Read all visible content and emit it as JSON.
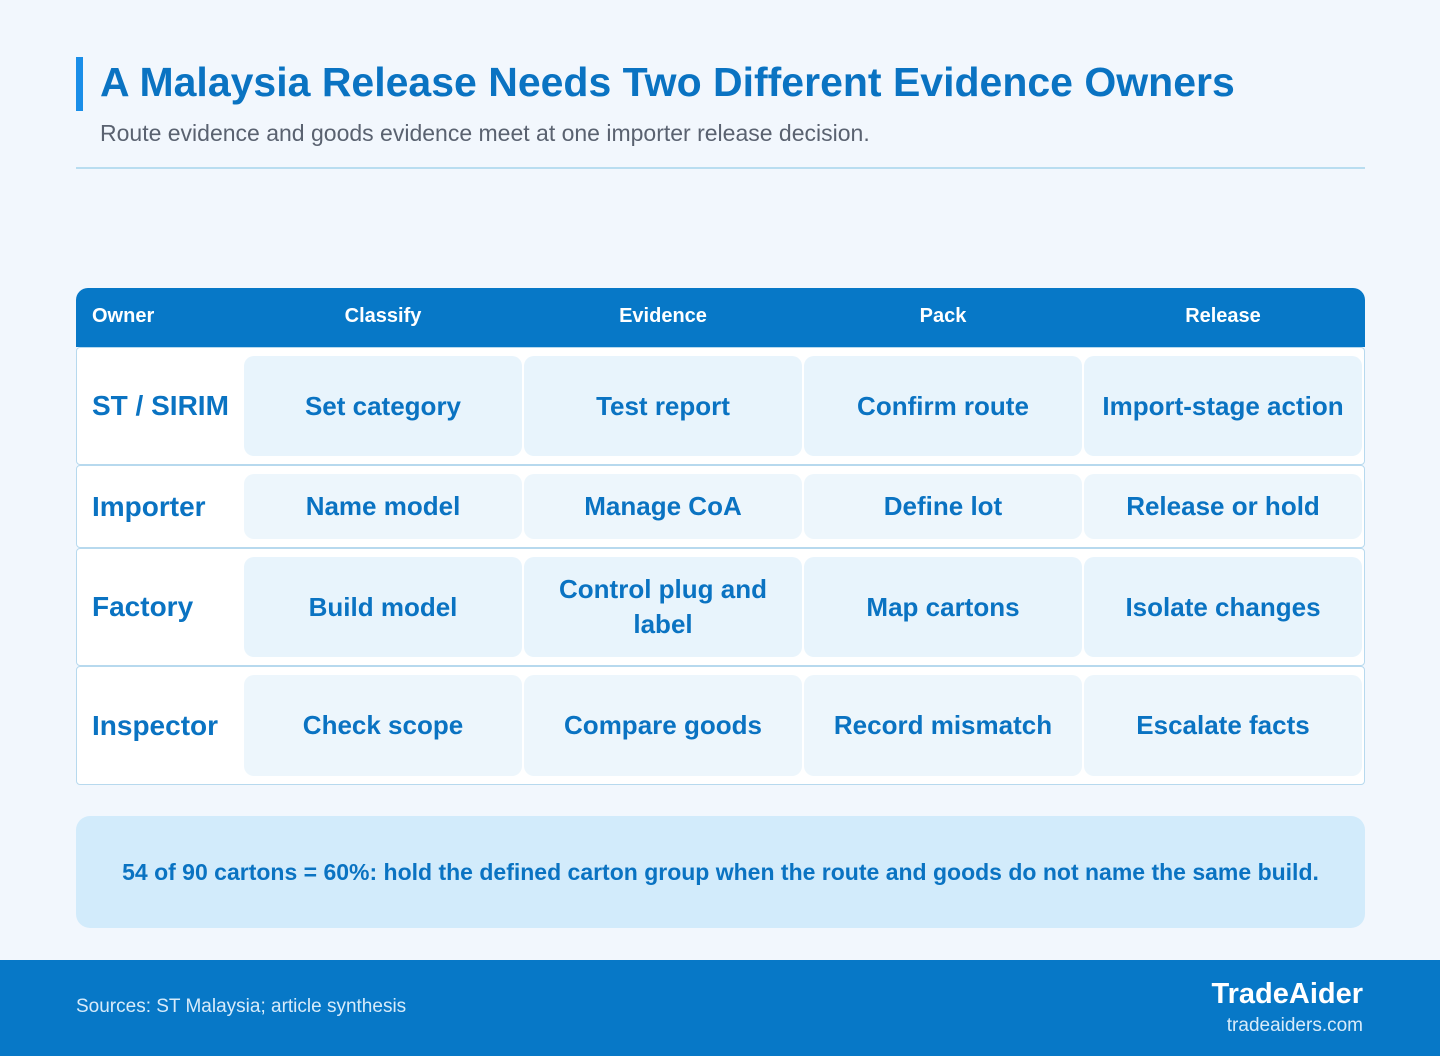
{
  "header": {
    "title": "A Malaysia Release Needs Two Different Evidence Owners",
    "subtitle": "Route evidence and goods evidence meet at one importer release decision."
  },
  "matrix": {
    "columns": [
      "Owner",
      "Classify",
      "Evidence",
      "Pack",
      "Release"
    ],
    "rows": [
      {
        "owner": "ST / SIRIM",
        "cells": [
          "Set category",
          "Test report",
          "Confirm route",
          "Import-stage action"
        ]
      },
      {
        "owner": "Importer",
        "cells": [
          "Name model",
          "Manage CoA",
          "Define lot",
          "Release or hold"
        ]
      },
      {
        "owner": "Factory",
        "cells": [
          "Build model",
          "Control plug and label",
          "Map cartons",
          "Isolate changes"
        ]
      },
      {
        "owner": "Inspector",
        "cells": [
          "Check scope",
          "Compare goods",
          "Record mismatch",
          "Escalate facts"
        ]
      }
    ]
  },
  "callout": {
    "text": "54 of 90 cartons = 60%: hold the defined carton group when the route and goods do not name the same build."
  },
  "footer": {
    "sources": "Sources: ST Malaysia; article synthesis",
    "brand": "TradeAider",
    "url": "tradeaiders.com"
  },
  "colors": {
    "accent": "#0778c7",
    "title": "#0a73c2",
    "cell_bg": "#e8f4fc",
    "callout_bg": "#d2ebfb",
    "page_bg": "#f2f7fd"
  }
}
